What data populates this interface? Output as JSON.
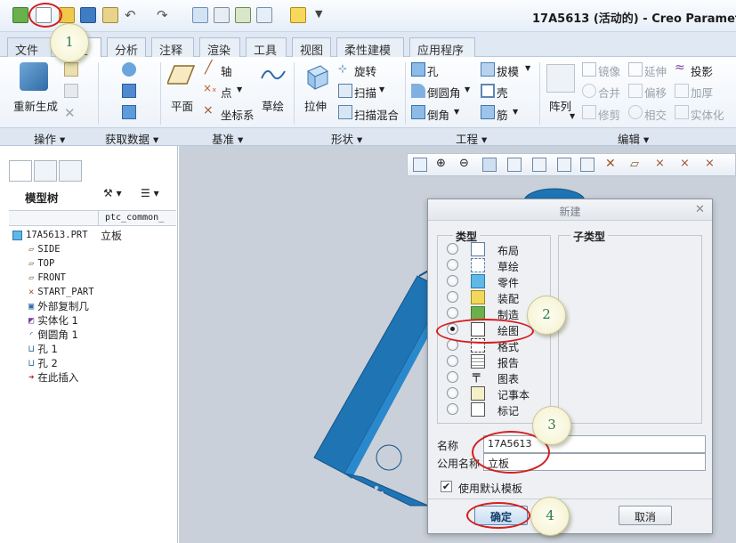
{
  "window": {
    "title": "17A5613 (活动的) - Creo Parametric"
  },
  "tabs": [
    {
      "label": "文件"
    },
    {
      "label": "模型"
    },
    {
      "label": "分析"
    },
    {
      "label": "注释"
    },
    {
      "label": "渲染"
    },
    {
      "label": "工具"
    },
    {
      "label": "视图"
    },
    {
      "label": "柔性建模"
    },
    {
      "label": "应用程序"
    }
  ],
  "ribbon": {
    "operations": {
      "regenerate": "重新生成"
    },
    "datum": {
      "plane": "平面",
      "axis": "轴",
      "point": "点",
      "csys": "坐标系",
      "sketch": "草绘"
    },
    "shapes": {
      "extrude": "拉伸",
      "revolve": "旋转",
      "sweep": "扫描",
      "blend": "扫描混合"
    },
    "engineering": {
      "hole": "孔",
      "round": "倒圆角",
      "chamfer": "倒角",
      "draft": "拔模",
      "shell": "壳",
      "rib": "筋"
    },
    "editing": {
      "pattern": "阵列",
      "mirror": "镜像",
      "extend": "延伸",
      "project": "投影",
      "merge": "合并",
      "offset": "偏移",
      "thicken": "加厚",
      "trim": "修剪",
      "intersect": "相交",
      "solidify": "实体化"
    },
    "groups": [
      "操作",
      "获取数据",
      "基准",
      "形状",
      "工程",
      "编辑"
    ]
  },
  "model_tree": {
    "title": "模型树",
    "column_header": "ptc_common_",
    "root": {
      "name": "17A5613.PRT",
      "value": "立板"
    },
    "items": [
      {
        "label": "SIDE"
      },
      {
        "label": "TOP"
      },
      {
        "label": "FRONT"
      },
      {
        "label": "START_PART"
      },
      {
        "label": "外部复制几"
      },
      {
        "label": "实体化 1"
      },
      {
        "label": "倒圆角 1"
      },
      {
        "label": "孔 1"
      },
      {
        "label": "孔 2"
      },
      {
        "label": "在此插入"
      }
    ]
  },
  "dialog": {
    "title": "新建",
    "type_group": "类型",
    "subtype_group": "子类型",
    "types": [
      {
        "label": "布局",
        "selected": false
      },
      {
        "label": "草绘",
        "selected": false
      },
      {
        "label": "零件",
        "selected": false
      },
      {
        "label": "装配",
        "selected": false
      },
      {
        "label": "制造",
        "selected": false
      },
      {
        "label": "绘图",
        "selected": true
      },
      {
        "label": "格式",
        "selected": false
      },
      {
        "label": "报告",
        "selected": false
      },
      {
        "label": "图表",
        "selected": false
      },
      {
        "label": "记事本",
        "selected": false
      },
      {
        "label": "标记",
        "selected": false
      }
    ],
    "name_label": "名称",
    "name_value": "17A5613",
    "common_name_label": "公用名称",
    "common_name_value": "立板",
    "default_template_label": "使用默认模板",
    "default_template_checked": true,
    "ok_label": "确定",
    "cancel_label": "取消"
  },
  "callouts": [
    "1",
    "2",
    "3",
    "4"
  ],
  "colors": {
    "model_blue": "#1f74b4",
    "ring_red": "#d31f1f",
    "callout_green": "#2c7a49"
  }
}
